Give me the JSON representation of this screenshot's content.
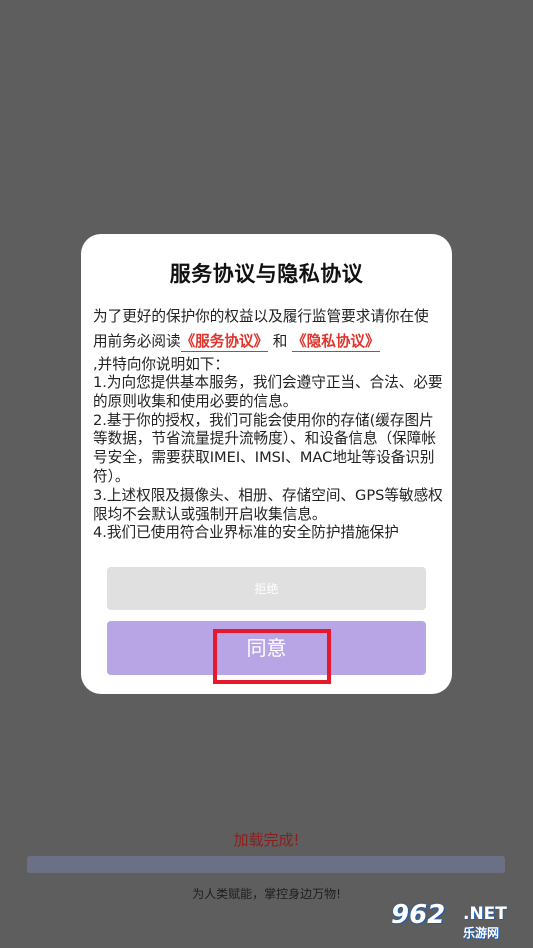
{
  "dialog": {
    "title": "服务协议与隐私协议",
    "intro_text_1": "为了更好的保护你的权益以及履行监管要求请你在使用前务必阅读",
    "service_link": "《服务协议》",
    "and_text": "和",
    "privacy_link": "《隐私协议》",
    "lead_text": ",并特向你说明如下：",
    "terms": [
      " 1.为向您提供基本服务，我们会遵守正当、合法、必要的原则收集和使用必要的信息。",
      " 2.基于你的授权，我们可能会使用你的存储(缓存图片等数据，节省流量提升流畅度）、和设备信息（保障帐号安全，需要获取IMEI、IMSI、MAC地址等设备识别符）。",
      " 3.上述权限及摄像头、相册、存储空间、GPS等敏感权限均不会默认或强制开启收集信息。",
      " 4.我们已使用符合业界标准的安全防护措施保护"
    ],
    "reject_label": "拒绝",
    "agree_label": "同意"
  },
  "status": {
    "loading_text": "加载完成!",
    "progress": 1.0,
    "slogan": "为人类赋能，掌控身边万物!"
  },
  "watermark": {
    "number": "962",
    "domain": ".NET",
    "name": "乐游网"
  },
  "colors": {
    "overlay": "#5e5e5e",
    "link": "#e0342c",
    "agree_button": "#b8a5e6",
    "reject_button": "#e0e0e0",
    "highlight": "#e8182c",
    "loading_text": "#8a1f1f"
  }
}
